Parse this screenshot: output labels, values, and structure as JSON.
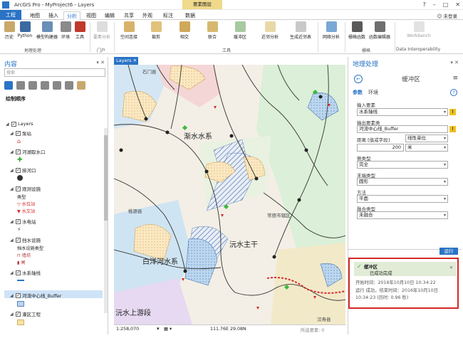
{
  "app": {
    "title": "ArcGIS Pro - MyProject6 - Layers",
    "context_tab": "要素图层",
    "user": "未登录"
  },
  "ribbon": {
    "tabs": [
      "工程",
      "地图",
      "插入",
      "分析",
      "视图",
      "编辑",
      "共享",
      "外观",
      "标注",
      "数据"
    ],
    "buttons": [
      "历史",
      "Python",
      "模型构建器",
      "环境",
      "工具",
      "要素分析",
      "空间连接",
      "裁剪",
      "相交",
      "联合",
      "缓冲区",
      "近邻分析",
      "生成近邻表",
      "网络分析",
      "栅格函数",
      "函数编辑器",
      "Workbench"
    ],
    "groups": [
      "地理处理",
      "门户",
      "工具",
      "栅格",
      "Data Interoperability"
    ]
  },
  "contents": {
    "title": "内容",
    "search_placeholder": "搜索",
    "draw_order": "绘制顺序",
    "root": "Layers",
    "layers": [
      "泵站",
      "河湖取水口",
      "排河口",
      "观测设施",
      "水电站",
      "挡水设施",
      "水系轴线",
      "河流中心线_Buffer",
      "灌区工程"
    ],
    "legend_type_label": "类型",
    "legend_obs_1": "水位站",
    "legend_obs_2": "水文站",
    "legend_dam_head": "挡水设施类型",
    "legend_dam_1": "墙坊",
    "legend_dam_2": "闸"
  },
  "map": {
    "tab": "Layers",
    "labels": [
      "渐水水系",
      "沅水主干",
      "白洋河水系",
      "沅水上游段",
      "石门县",
      "桃源县",
      "常德市辖区",
      "汉寿县"
    ],
    "scale": "1:258,070",
    "coords": "111.76E 29.08N",
    "selected": "所选要素: 0"
  },
  "geoprocessing": {
    "title": "地理处理",
    "tool": "缓冲区",
    "tab_params": "参数",
    "tab_env": "环境",
    "input_label": "输入要素",
    "input_value": "水系轴线",
    "output_label": "输出要素类",
    "output_value": "河流中心线_Buffer",
    "distance_label": "距离 [值或字段]",
    "distance_mode": "线性单位",
    "distance_value": "200",
    "distance_unit": "米",
    "side_label": "侧类型",
    "side_value": "完全",
    "end_label": "末端类型",
    "end_value": "圆形",
    "method_label": "方法",
    "method_value": "平面",
    "dissolve_label": "融合类型",
    "dissolve_value": "未融合",
    "run": "运行",
    "result_title": "缓冲区",
    "result_status": "已成功完成",
    "result_start": "开始时间：2016年10月10日 10:34:22",
    "result_line2": "运行 成功，结束时间：2016年10月10日",
    "result_line3": "10:34:23 (历时: 0.96 秒)"
  },
  "colors": {
    "accent": "#2a73c6",
    "result_border": "#d42a2a",
    "context": "#f0d98a"
  }
}
